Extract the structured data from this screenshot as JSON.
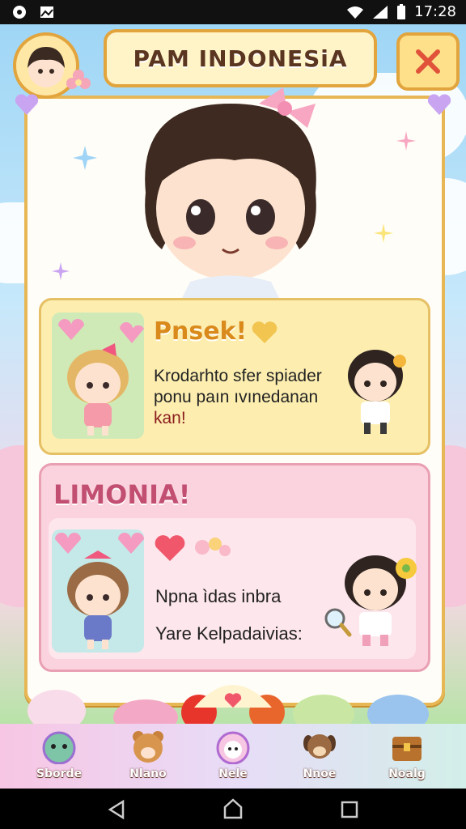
{
  "status": {
    "time": "17:28"
  },
  "header": {
    "title": "PAM INDONESiA"
  },
  "panel1": {
    "title": "Pnsek!",
    "lines": [
      "Krodarhto sfer spiader",
      "ponu paın ıvınedanan",
      "kan!"
    ]
  },
  "panel2": {
    "title": "LIMONIA!",
    "line1": "Npna ìdas inbra",
    "line2": "Yare Kelpadaivias:"
  },
  "tabs": [
    {
      "label": "Sborde",
      "icon": "frog-icon"
    },
    {
      "label": "Nlano",
      "icon": "bear-icon"
    },
    {
      "label": "Nele",
      "icon": "bunny-icon"
    },
    {
      "label": "Nnoe",
      "icon": "dog-icon"
    },
    {
      "label": "Noalg",
      "icon": "treasure-chest-icon"
    }
  ],
  "colors": {
    "frame": "#e2a43c",
    "panel1": "#fdeeb0",
    "panel2": "#fbd3de"
  }
}
